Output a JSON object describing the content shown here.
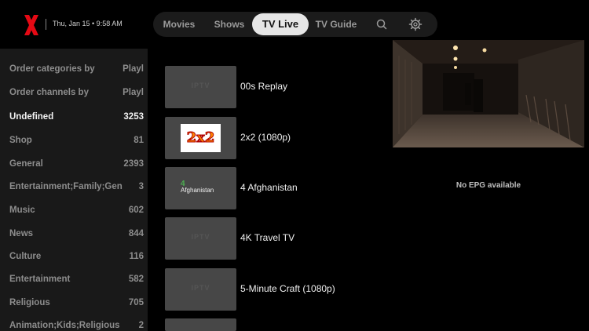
{
  "header": {
    "logo_icon": "x-logo-icon",
    "datetime": "Thu, Jan 15 • 9:58 AM",
    "accent_color": "#e50914"
  },
  "nav": {
    "items": [
      {
        "label": "Movies"
      },
      {
        "label": "Shows"
      },
      {
        "label": "TV Live",
        "active": true
      },
      {
        "label": "TV Guide"
      }
    ],
    "search_icon": "search-icon",
    "settings_icon": "gear-icon"
  },
  "sidebar": {
    "rows": [
      {
        "label": "Order categories by",
        "value": "Playl"
      },
      {
        "label": "Order channels by",
        "value": "Playl"
      },
      {
        "label": "Undefined",
        "value": "3253",
        "selected": true
      },
      {
        "label": "Shop",
        "value": "81"
      },
      {
        "label": "General",
        "value": "2393"
      },
      {
        "label": "Entertainment;Family;Gen",
        "value": "3"
      },
      {
        "label": "Music",
        "value": "602"
      },
      {
        "label": "News",
        "value": "844"
      },
      {
        "label": "Culture",
        "value": "116"
      },
      {
        "label": "Entertainment",
        "value": "582"
      },
      {
        "label": "Religious",
        "value": "705"
      },
      {
        "label": "Animation;Kids;Religious",
        "value": "2"
      }
    ]
  },
  "channels": [
    {
      "name": "00s Replay",
      "logo": "iptv-placeholder",
      "placeholder_text": "IPTV"
    },
    {
      "name": "2x2 (1080p)",
      "logo": "2x2-logo",
      "logo_text": "2x2"
    },
    {
      "name": "4 Afghanistan",
      "logo": "4-afghanistan-logo",
      "logo_text": "Afghanistan"
    },
    {
      "name": "4K Travel TV",
      "logo": "iptv-placeholder",
      "placeholder_text": "IPTV"
    },
    {
      "name": "5-Minute Craft (1080p)",
      "logo": "iptv-placeholder",
      "placeholder_text": "IPTV"
    }
  ],
  "preview": {
    "epg_text": "No EPG available"
  }
}
